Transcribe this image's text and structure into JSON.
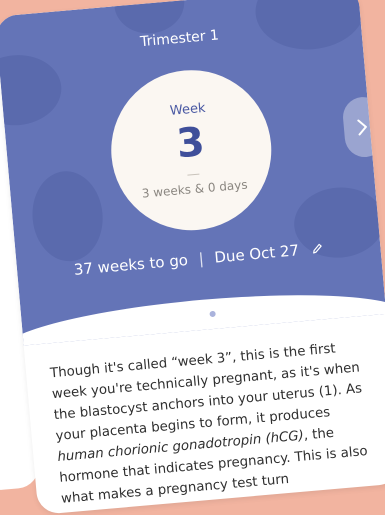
{
  "header": {
    "trimester": "Trimester 1"
  },
  "week_circle": {
    "label": "Week",
    "number": "3",
    "detail": "3 weeks & 0 days"
  },
  "due": {
    "weeks_to_go": "37 weeks to go",
    "separator": "|",
    "due_date": "Due Oct 27",
    "edit_icon": "pencil-icon"
  },
  "pager": {
    "dots": 2,
    "active_index": 0
  },
  "next_icon": "chevron-right-icon",
  "body": {
    "part1": "Though it's called “week 3”, this is the first week you're technically pregnant, as it's when the blastocyst anchors into your uterus (1). As your placenta begins to form, it produces ",
    "italic": "human chorionic gonadotropin (hCG)",
    "part2": ", the hormone that indicates pregnancy. This is also what makes a pregnancy test turn"
  },
  "colors": {
    "background": "#f2b4a0",
    "hero": "#6474b7",
    "accent": "#3f4f9a"
  }
}
